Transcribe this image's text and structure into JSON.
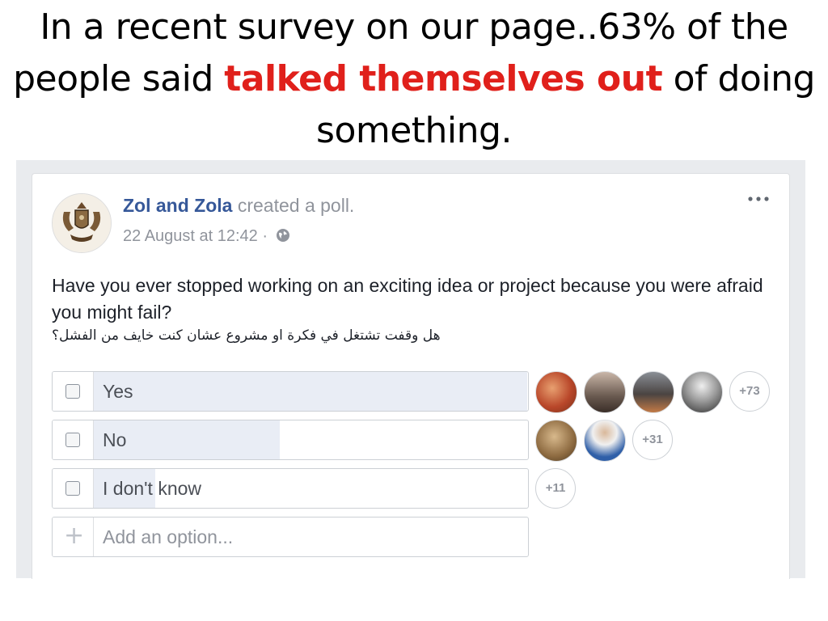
{
  "slide": {
    "title_part1": "In a recent survey on our page..63% of the people said ",
    "title_highlight": "talked themselves out",
    "title_part2": " of doing something.",
    "highlight_color": "#e0201b"
  },
  "post": {
    "author": "Zol and Zola",
    "action": " created a poll.",
    "timestamp": "22 August at 12:42",
    "separator": " · ",
    "question": "Have you ever stopped working on an exciting idea or project because you were afraid you might fail?",
    "question_ar": "هل وقفت تشتغل في فكرة او مشروع عشان كنت خايف من الفشل؟"
  },
  "poll": {
    "options": [
      {
        "label": "Yes",
        "fill_fraction": 1.0,
        "voter_avatars": 4,
        "more_count": "+73"
      },
      {
        "label": "No",
        "fill_fraction": 0.43,
        "voter_avatars": 2,
        "more_count": "+31"
      },
      {
        "label": "I don't know",
        "fill_fraction": 0.14,
        "voter_avatars": 0,
        "more_count": "+11"
      }
    ],
    "add_option_placeholder": "Add an option..."
  },
  "colors": {
    "link": "#365899",
    "meta": "#90949c",
    "bar_fill": "#e9edf5"
  }
}
